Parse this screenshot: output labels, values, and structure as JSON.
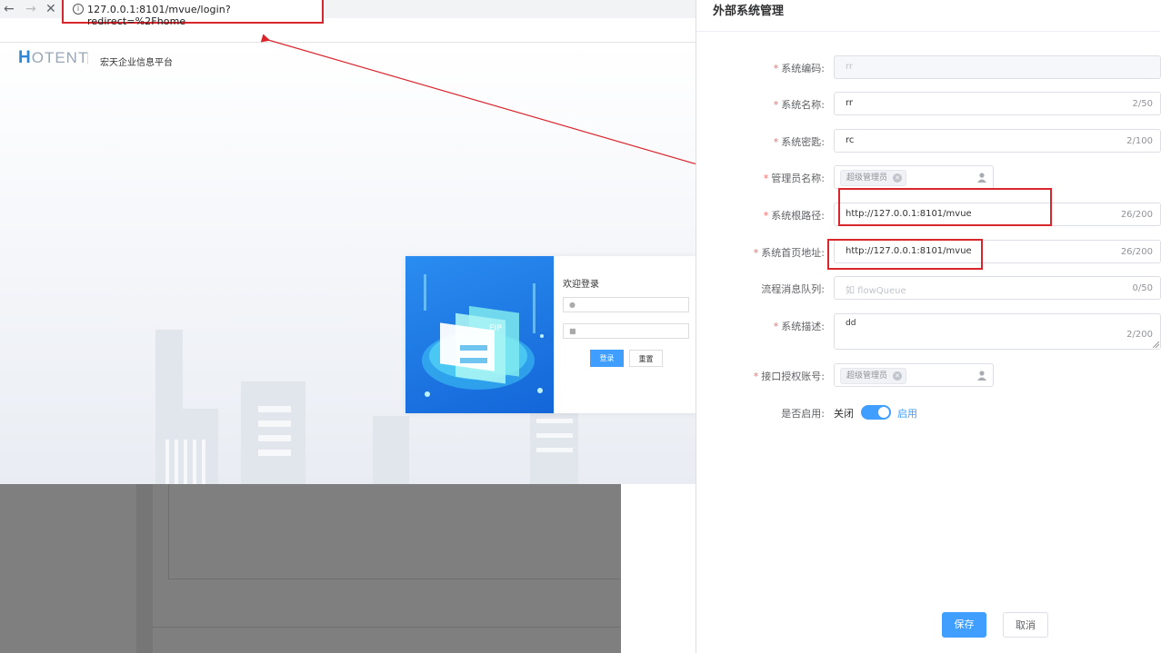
{
  "browser": {
    "url": "127.0.0.1:8101/mvue/login?redirect=%2Fhome",
    "back_icon": "arrow-left-icon",
    "forward_icon": "arrow-right-icon",
    "close_icon": "close-icon"
  },
  "login_page": {
    "logo_prefix": "H",
    "logo_rest": "OTENT",
    "platform_name": "宏天企业信息平台",
    "welcome": "欢迎登录",
    "login_button": "登录",
    "reset_button": "重置",
    "illustration_text": "EIP"
  },
  "drawer": {
    "title": "外部系统管理",
    "fields": {
      "code": {
        "label": "系统编码:",
        "value": "rr",
        "required": true
      },
      "name": {
        "label": "系统名称:",
        "value": "rr",
        "count": "2/50",
        "required": true
      },
      "secret": {
        "label": "系统密匙:",
        "value": "rc",
        "count": "2/100",
        "required": true
      },
      "admin": {
        "label": "管理员名称:",
        "tag": "超级管理员",
        "required": true
      },
      "root_path": {
        "label": "系统根路径:",
        "value": "http://127.0.0.1:8101/mvue",
        "count": "26/200",
        "required": true
      },
      "home_url": {
        "label": "系统首页地址:",
        "value": "http://127.0.0.1:8101/mvue",
        "count": "26/200",
        "required": true
      },
      "queue": {
        "label": "流程消息队列:",
        "placeholder": "如 flowQueue",
        "count": "0/50",
        "required": false
      },
      "description": {
        "label": "系统描述:",
        "value": "dd",
        "count": "2/200",
        "required": true
      },
      "auth_account": {
        "label": "接口授权账号:",
        "tag": "超级管理员",
        "required": true
      },
      "enabled": {
        "label": "是否启用:",
        "off_text": "关闭",
        "on_text": "启用",
        "state": "on"
      }
    },
    "required_mark": "*",
    "save_button": "保存",
    "cancel_button": "取消"
  },
  "colors": {
    "accent": "#409eff",
    "annotation_red": "#d9262d",
    "overlay": "#7f7f7f"
  }
}
